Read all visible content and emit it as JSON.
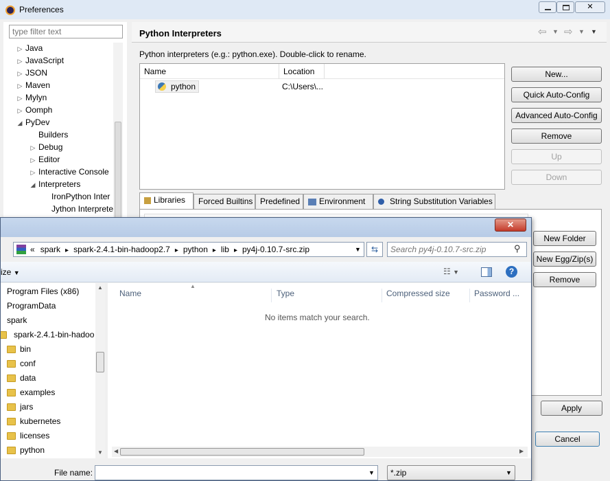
{
  "prefs": {
    "title": "Preferences",
    "filter_placeholder": "type filter text",
    "tree": [
      {
        "label": "Java",
        "indent": 0,
        "tw": "▷"
      },
      {
        "label": "JavaScript",
        "indent": 0,
        "tw": "▷"
      },
      {
        "label": "JSON",
        "indent": 0,
        "tw": "▷"
      },
      {
        "label": "Maven",
        "indent": 0,
        "tw": "▷"
      },
      {
        "label": "Mylyn",
        "indent": 0,
        "tw": "▷"
      },
      {
        "label": "Oomph",
        "indent": 0,
        "tw": "▷"
      },
      {
        "label": "PyDev",
        "indent": 0,
        "tw": "◢"
      },
      {
        "label": "Builders",
        "indent": 1,
        "tw": ""
      },
      {
        "label": "Debug",
        "indent": 1,
        "tw": "▷"
      },
      {
        "label": "Editor",
        "indent": 1,
        "tw": "▷"
      },
      {
        "label": "Interactive Console",
        "indent": 1,
        "tw": "▷"
      },
      {
        "label": "Interpreters",
        "indent": 1,
        "tw": "◢"
      },
      {
        "label": "IronPython Inter",
        "indent": 2,
        "tw": ""
      },
      {
        "label": "Jython Interprete",
        "indent": 2,
        "tw": ""
      }
    ],
    "page_title": "Python Interpreters",
    "description": "Python interpreters (e.g.: python.exe).  Double-click to rename.",
    "table": {
      "headers": [
        "Name",
        "Location"
      ],
      "rows": [
        {
          "name": "python",
          "location": "C:\\Users\\..."
        }
      ]
    },
    "buttons": {
      "new": "New...",
      "quick": "Quick Auto-Config",
      "advanced": "Advanced Auto-Config",
      "remove": "Remove",
      "up": "Up",
      "down": "Down"
    },
    "tabs": [
      "Libraries",
      "Forced Builtins",
      "Predefined",
      "Environment",
      "String Substitution Variables"
    ],
    "lib_buttons": {
      "new_folder": "New Folder",
      "new_egg": "New Egg/Zip(s)",
      "remove": "Remove"
    },
    "apply": "Apply",
    "cancel": "Cancel"
  },
  "dialog": {
    "breadcrumb": [
      "«",
      "spark",
      "spark-2.4.1-bin-hadoop2.7",
      "python",
      "lib",
      "py4j-0.10.7-src.zip"
    ],
    "search_placeholder": "Search py4j-0.10.7-src.zip",
    "organize": "ize",
    "sidebar": [
      {
        "label": "Program Files (x86)",
        "indent": 0
      },
      {
        "label": "ProgramData",
        "indent": 0
      },
      {
        "label": "spark",
        "indent": 0
      },
      {
        "label": "spark-2.4.1-bin-hadoo",
        "indent": 1
      },
      {
        "label": "bin",
        "indent": 2
      },
      {
        "label": "conf",
        "indent": 2
      },
      {
        "label": "data",
        "indent": 2
      },
      {
        "label": "examples",
        "indent": 2
      },
      {
        "label": "jars",
        "indent": 2
      },
      {
        "label": "kubernetes",
        "indent": 2
      },
      {
        "label": "licenses",
        "indent": 2
      },
      {
        "label": "python",
        "indent": 2
      }
    ],
    "columns": [
      "Name",
      "Type",
      "Compressed size",
      "Password ..."
    ],
    "empty_message": "No items match your search.",
    "filename_label": "File name:",
    "filename_value": "",
    "filter_value": "*.zip",
    "close_symbol": "✕"
  }
}
